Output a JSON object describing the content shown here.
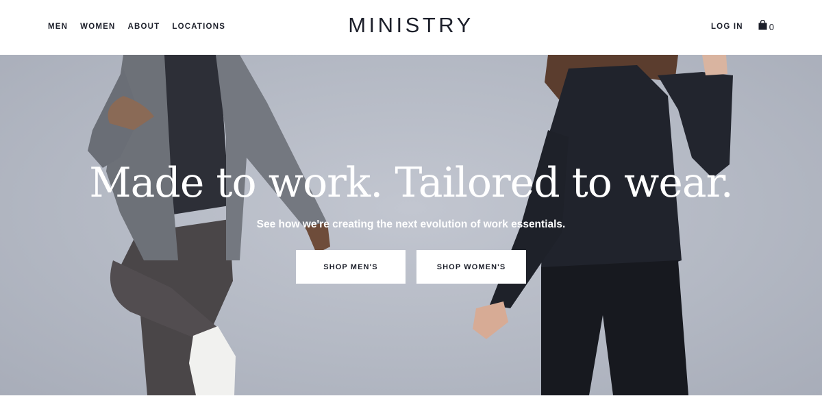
{
  "header": {
    "nav_left": [
      "MEN",
      "WOMEN",
      "ABOUT",
      "LOCATIONS"
    ],
    "logo": "MINISTRY",
    "login_label": "LOG IN",
    "cart_icon": "shopping-bag-icon",
    "cart_count": "0"
  },
  "hero": {
    "headline": "Made to work. Tailored to wear.",
    "subheadline": "See how we're creating the next evolution of work essentials.",
    "buttons": {
      "shop_mens": "SHOP MEN'S",
      "shop_womens": "SHOP WOMEN'S"
    }
  },
  "colors": {
    "text_dark": "#1c1f2a",
    "hero_background": "#b4b9c4",
    "button_background": "#ffffff"
  }
}
